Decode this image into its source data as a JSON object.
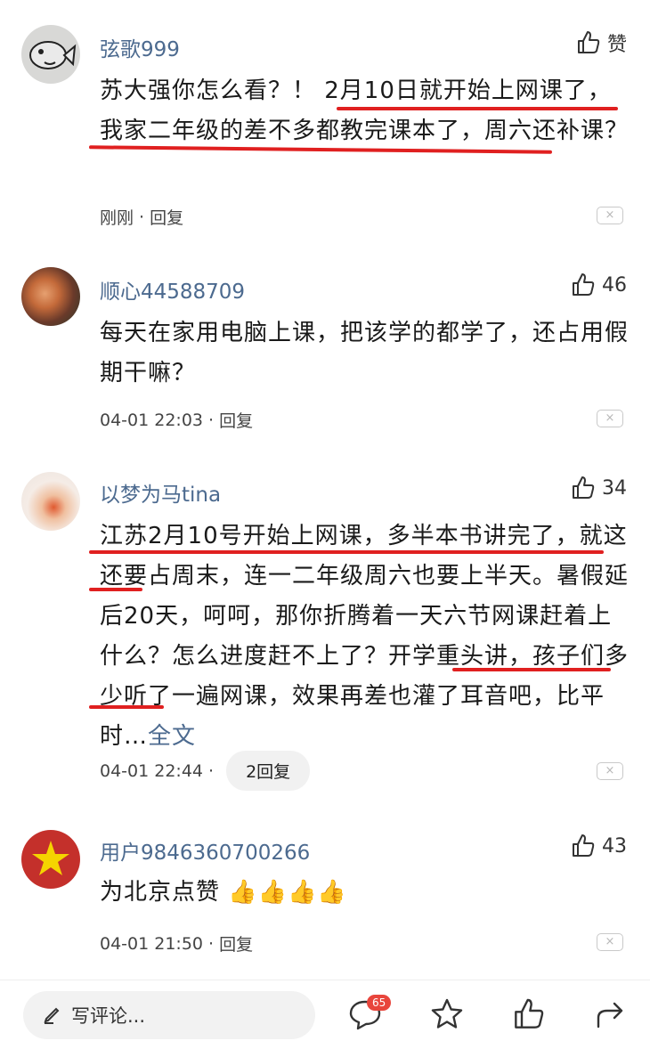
{
  "comments": [
    {
      "username": "弦歌999",
      "like_label": "赞",
      "text": "苏大强你怎么看？！ 2月10日就开始上网课了，我家二年级的差不多都教完课本了，周六还补课？",
      "time": "刚刚",
      "reply_label": "回复",
      "dismiss": "×"
    },
    {
      "username": "顺心44588709",
      "likes": "46",
      "text": "每天在家用电脑上课，把该学的都学了，还占用假期干嘛？",
      "time": "04-01 22:03",
      "reply_label": "回复",
      "dismiss": "×"
    },
    {
      "username": "以梦为马tina",
      "likes": "34",
      "text": "江苏2月10号开始上网课，多半本书讲完了，就这还要占周末，连一二年级周六也要上半天。暑假延后20天，呵呵，那你折腾着一天六节网课赶着上什么？怎么进度赶不上了？开学重头讲，孩子们多少听了一遍网课，效果再差也灌了耳音吧，比平时…",
      "more_label": "全文",
      "time": "04-01 22:44",
      "reply_label": "2回复",
      "dismiss": "×"
    },
    {
      "username": "用户9846360700266",
      "likes": "43",
      "text": "为北京点赞",
      "emoji": "👍👍👍👍",
      "time": "04-01 21:50",
      "reply_label": "回复",
      "dismiss": "×"
    }
  ],
  "bottom_bar": {
    "placeholder": "写评论...",
    "comment_count": "65"
  },
  "colors": {
    "username": "#4c6a8f",
    "underline": "#e02020",
    "badge": "#e8453c"
  }
}
